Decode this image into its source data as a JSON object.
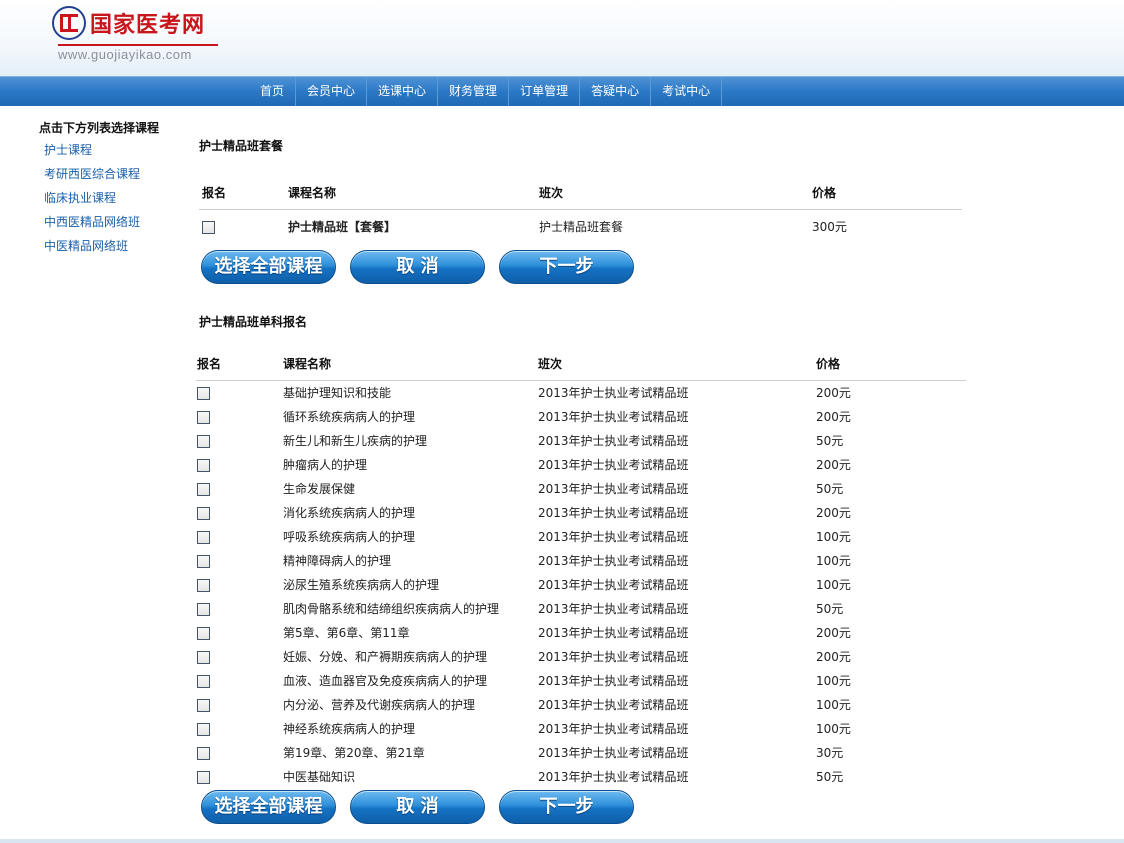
{
  "site": {
    "title": "国家医考网",
    "url": "www.guojiayikao.com"
  },
  "nav": {
    "items": [
      "首页",
      "会员中心",
      "选课中心",
      "财务管理",
      "订单管理",
      "答疑中心",
      "考试中心"
    ]
  },
  "sidebar": {
    "title": "点击下方列表选择课程",
    "items": [
      "护士课程",
      "考研西医综合课程",
      "临床执业课程",
      "中西医精品网络班",
      "中医精品网络班"
    ]
  },
  "package_section": {
    "title": "护士精品班套餐",
    "headers": [
      "报名",
      "课程名称",
      "班次",
      "价格"
    ],
    "rows": [
      {
        "name": "护士精品班【套餐】",
        "class": "护士精品班套餐",
        "price": "300元"
      }
    ]
  },
  "single_section": {
    "title": "护士精品班单科报名",
    "headers": [
      "报名",
      "课程名称",
      "班次",
      "价格"
    ],
    "rows": [
      {
        "name": "基础护理知识和技能",
        "class": "2013年护士执业考试精品班",
        "price": "200元"
      },
      {
        "name": "循环系统疾病病人的护理",
        "class": "2013年护士执业考试精品班",
        "price": "200元"
      },
      {
        "name": "新生儿和新生儿疾病的护理",
        "class": "2013年护士执业考试精品班",
        "price": "50元"
      },
      {
        "name": "肿瘤病人的护理",
        "class": "2013年护士执业考试精品班",
        "price": "200元"
      },
      {
        "name": "生命发展保健",
        "class": "2013年护士执业考试精品班",
        "price": "50元"
      },
      {
        "name": "消化系统疾病病人的护理",
        "class": "2013年护士执业考试精品班",
        "price": "200元"
      },
      {
        "name": "呼吸系统疾病病人的护理",
        "class": "2013年护士执业考试精品班",
        "price": "100元"
      },
      {
        "name": "精神障碍病人的护理",
        "class": "2013年护士执业考试精品班",
        "price": "100元"
      },
      {
        "name": "泌尿生殖系统疾病病人的护理",
        "class": "2013年护士执业考试精品班",
        "price": "100元"
      },
      {
        "name": "肌肉骨骼系统和结缔组织疾病病人的护理",
        "class": "2013年护士执业考试精品班",
        "price": "50元"
      },
      {
        "name": "第5章、第6章、第11章",
        "class": "2013年护士执业考试精品班",
        "price": "200元"
      },
      {
        "name": "妊娠、分娩、和产褥期疾病病人的护理",
        "class": "2013年护士执业考试精品班",
        "price": "200元"
      },
      {
        "name": "血液、造血器官及免疫疾病病人的护理",
        "class": "2013年护士执业考试精品班",
        "price": "100元"
      },
      {
        "name": "内分泌、营养及代谢疾病病人的护理",
        "class": "2013年护士执业考试精品班",
        "price": "100元"
      },
      {
        "name": "神经系统疾病病人的护理",
        "class": "2013年护士执业考试精品班",
        "price": "100元"
      },
      {
        "name": "第19章、第20章、第21章",
        "class": "2013年护士执业考试精品班",
        "price": "30元"
      },
      {
        "name": "中医基础知识",
        "class": "2013年护士执业考试精品班",
        "price": "50元"
      }
    ]
  },
  "buttons": {
    "select_all": "选择全部课程",
    "cancel": "取 消",
    "next": "下一步"
  }
}
